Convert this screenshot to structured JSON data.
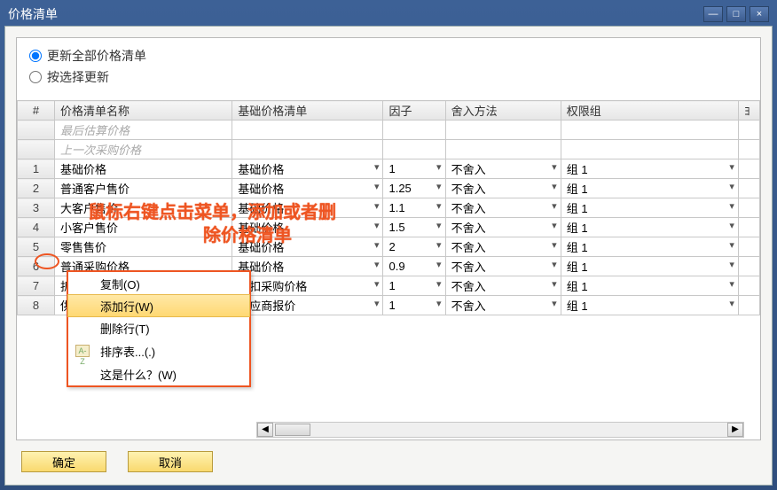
{
  "window": {
    "title": "价格清单"
  },
  "win_btns": {
    "min": "—",
    "max": "□",
    "close": "×"
  },
  "radios": {
    "update_all": "更新全部价格清单",
    "by_select": "按选择更新",
    "selected": "update_all"
  },
  "columns": {
    "num": "#",
    "name": "价格清单名称",
    "base": "基础价格清单",
    "factor": "因子",
    "round": "舍入方法",
    "group": "权限组",
    "extra": "ﾖ"
  },
  "info_rows": [
    "最后估算价格",
    "上一次采购价格"
  ],
  "rows": [
    {
      "n": "1",
      "name": "基础价格",
      "base": "基础价格",
      "factor": "1",
      "round": "不舍入",
      "group": "组 1"
    },
    {
      "n": "2",
      "name": "普通客户售价",
      "base": "基础价格",
      "factor": "1.25",
      "round": "不舍入",
      "group": "组 1"
    },
    {
      "n": "3",
      "name": "大客户售价",
      "base": "基础价格",
      "factor": "1.1",
      "round": "不舍入",
      "group": "组 1"
    },
    {
      "n": "4",
      "name": "小客户售价",
      "base": "基础价格",
      "factor": "1.5",
      "round": "不舍入",
      "group": "组 1"
    },
    {
      "n": "5",
      "name": "零售售价",
      "base": "基础价格",
      "factor": "2",
      "round": "不舍入",
      "group": "组 1"
    },
    {
      "n": "6",
      "name": "普通采购价格",
      "base": "基础价格",
      "factor": "0.9",
      "round": "不舍入",
      "group": "组 1"
    },
    {
      "n": "7",
      "name": "折扣采购价格",
      "base": "折扣采购价格",
      "factor": "1",
      "round": "不舍入",
      "group": "组 1"
    },
    {
      "n": "8",
      "name": "供应商报价",
      "base": "供应商报价",
      "factor": "1",
      "round": "不舍入",
      "group": "组 1"
    }
  ],
  "annotation": {
    "line1": "鼠标右键点击菜单，添加或者删",
    "line2": "除价格清单"
  },
  "context_menu": {
    "copy": "复制(O)",
    "add_row": "添加行(W)",
    "del_row": "删除行(T)",
    "sort": "排序表...(.)",
    "whats": "这是什么？(W)",
    "sort_icon": "A-Z"
  },
  "footer": {
    "ok": "确定",
    "cancel": "取消"
  }
}
